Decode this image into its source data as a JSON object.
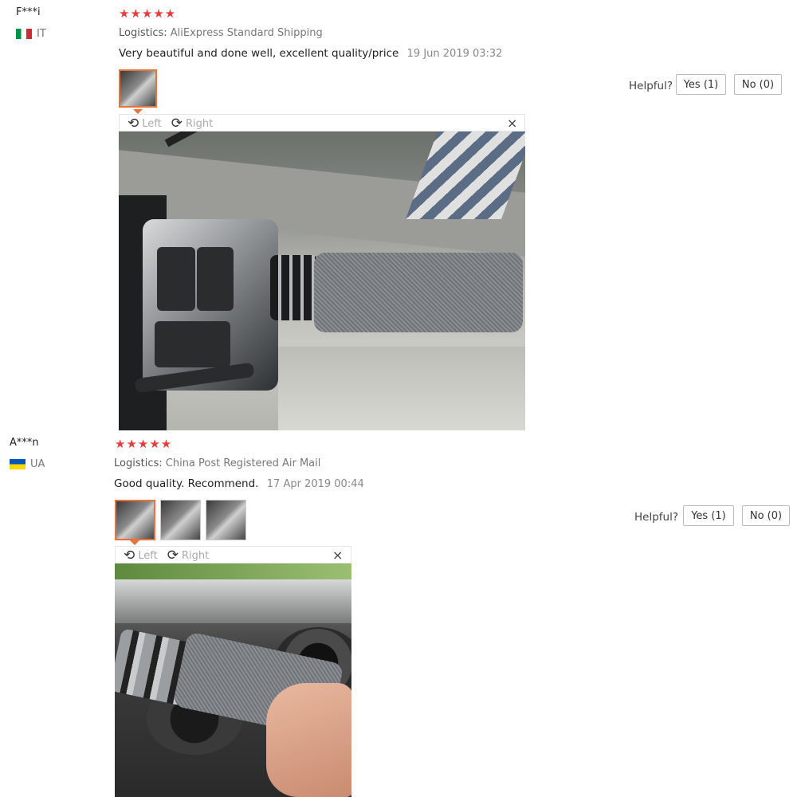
{
  "helpful_label": "Helpful?",
  "viewer": {
    "left_label": "Left",
    "right_label": "Right",
    "close_symbol": "×"
  },
  "reviews": [
    {
      "user": "F***i",
      "country": "IT",
      "stars": "★★★★★",
      "logistics_label": "Logistics:",
      "logistics_value": "AliExpress Standard Shipping",
      "feedback": "Very beautiful and done well, excellent quality/price",
      "date": "19 Jun 2019 03:32",
      "yes_label": "Yes (1)",
      "no_label": "No (0)"
    },
    {
      "user": "A***n",
      "country": "UA",
      "stars": "★★★★★",
      "logistics_label": "Logistics:",
      "logistics_value": "China Post Registered Air Mail",
      "feedback": "Good quality. Recommend.",
      "date": "17 Apr 2019 00:44",
      "yes_label": "Yes (1)",
      "no_label": "No (0)"
    }
  ],
  "colors": {
    "star": "#e63c3c",
    "active_thumb_border": "#e8733a",
    "flag_it": [
      "#009246",
      "#ffffff",
      "#ce2b37"
    ],
    "flag_ua": [
      "#0057b7",
      "#ffd700"
    ]
  }
}
